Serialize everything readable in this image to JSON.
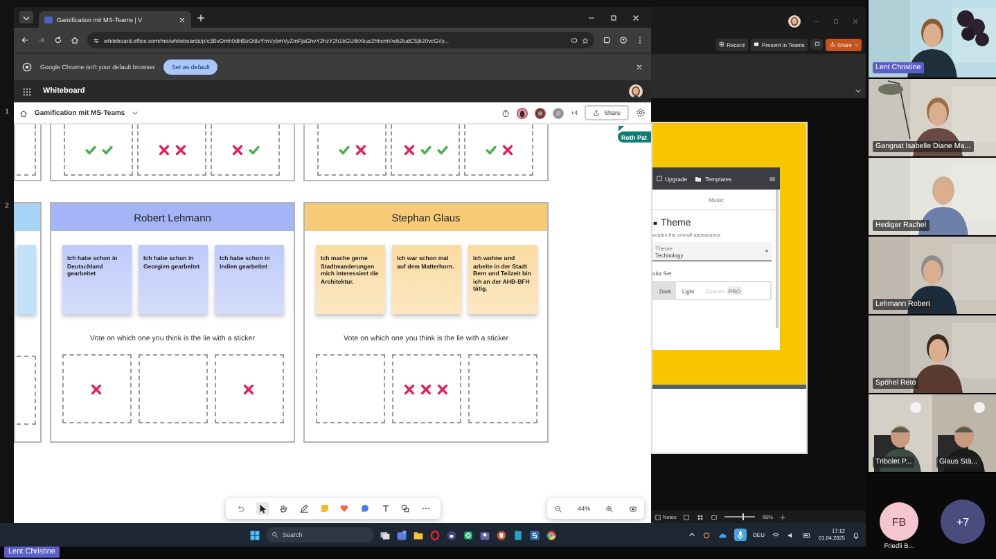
{
  "screen_share": {
    "slide_numbers": [
      "1",
      "2"
    ],
    "browser": {
      "tab_title": "Gamification mit MS-Teams | V",
      "url": "whiteboard.office.com/me/whiteboards/p/c3BvOmh0dHBzOi8vYmVybmVyZmFjaGhvY2hzY2h1bGUtbXkuc2hhcmVwb2ludC5jb20vcGVy...",
      "infobar_message": "Google Chrome isn't your default browser",
      "infobar_button": "Set as default",
      "app_name": "Whiteboard",
      "board_title": "Gamification mit MS-Teams",
      "extra_collaborators": "+4",
      "share": "Share"
    },
    "board": {
      "top_frames": [
        {
          "cut_off": true,
          "boxes": [
            {
              "kind": "vote-box"
            }
          ]
        },
        {
          "cut_off": false,
          "boxes": [
            {
              "kind": "vote-box",
              "stickers": [
                {
                  "kind": "check"
                },
                {
                  "kind": "check"
                }
              ]
            },
            {
              "kind": "vote-box",
              "stickers": [
                {
                  "kind": "cross"
                },
                {
                  "kind": "cross"
                }
              ]
            },
            {
              "kind": "vote-box",
              "stickers": [
                {
                  "kind": "cross"
                },
                {
                  "kind": "check"
                }
              ]
            }
          ]
        },
        {
          "cut_off": false,
          "boxes": [
            {
              "kind": "vote-box",
              "stickers": [
                {
                  "kind": "check"
                },
                {
                  "kind": "cross"
                }
              ]
            },
            {
              "kind": "vote-box",
              "stickers": [
                {
                  "kind": "cross"
                },
                {
                  "kind": "check"
                },
                {
                  "kind": "check"
                }
              ]
            },
            {
              "kind": "vote-box",
              "stickers": [
                {
                  "kind": "check"
                },
                {
                  "kind": "cross"
                }
              ]
            }
          ]
        }
      ],
      "frames": [
        {
          "cut_off": true,
          "color": "#a6d4f7"
        },
        {
          "cut_off": false,
          "color": "#a3b4f7",
          "name": "Robert Lehmann",
          "notes": [
            "Ich habe schon in Deutschland gearbeitet",
            "Ich habe schon in Georgien gearbeitet",
            "Ich habe schon in Indien gearbeitet"
          ],
          "prompt": "Vote on which one you think is the lie with a sticker",
          "boxes": [
            {
              "kind": "vote-box",
              "stickers": [
                {
                  "kind": "cross"
                }
              ]
            },
            {
              "kind": "vote-box"
            },
            {
              "kind": "vote-box",
              "stickers": [
                {
                  "kind": "cross"
                }
              ]
            }
          ]
        },
        {
          "cut_off": false,
          "color": "#f8cb79",
          "name": "Stephan Glaus",
          "notes": [
            "Ich mache gerne Stadtwanderungen mich interessiert die Architektur.",
            "Ich war schon mal auf dem Matterhorn.",
            "Ich wohne und arbeite in der Stadt Bern und Teilzeit bin ich an der AHB-BFH tätig."
          ],
          "prompt": "Vote on which one you think is the lie with a sticker",
          "boxes": [
            {
              "kind": "vote-box"
            },
            {
              "kind": "vote-box",
              "stickers": [
                {
                  "kind": "cross"
                },
                {
                  "kind": "cross"
                },
                {
                  "kind": "cross"
                }
              ]
            },
            {
              "kind": "vote-box"
            }
          ]
        }
      ],
      "cursor_label": "Roth Pat",
      "zoom": "44%"
    },
    "teams": {
      "record": "Record",
      "present": "Present in Teams",
      "share": "Share"
    },
    "slide": {
      "toolbar": [
        "Upgrade",
        "Templates"
      ],
      "tab": "Music",
      "theme_title": "Theme",
      "theme_description": "ecides the overall appearance",
      "field_label": "Theme",
      "field_value": "Technology",
      "color_set_label": "olor Set",
      "color_options": [
        {
          "label": "Dark",
          "selected": true
        },
        {
          "label": "Light",
          "selected": false
        },
        {
          "label": "Custom",
          "selected": false,
          "badge": "PRO"
        }
      ]
    },
    "ppt_status": {
      "notes": "Notes",
      "zoom": "90%",
      "level": 0.6
    },
    "taskbar": {
      "search": "Search",
      "language": "DEU",
      "time": "17:12",
      "date": "01.04.2025"
    }
  },
  "video_rows": [
    {
      "tiles": [
        {
          "name": "Lent Christine",
          "highlighted": true
        }
      ]
    },
    {
      "tiles": [
        {
          "name": "Gangnat Isabelle Diane Ma...",
          "highlighted": false
        }
      ]
    },
    {
      "tiles": [
        {
          "name": "Hediger Rachel",
          "highlighted": false
        }
      ]
    },
    {
      "tiles": [
        {
          "name": "Lehmann Robert",
          "highlighted": false
        }
      ]
    },
    {
      "tiles": [
        {
          "name": "Spöhel Reto",
          "highlighted": false
        }
      ]
    },
    {
      "tiles": [
        {
          "name": "Tribolet P...",
          "highlighted": false
        },
        {
          "name": "Glaus Stä...",
          "highlighted": false
        }
      ]
    }
  ],
  "self_label": "Lent Christine",
  "overflow": {
    "initials": "FB",
    "name": "Friedli B...",
    "more": "+7"
  }
}
